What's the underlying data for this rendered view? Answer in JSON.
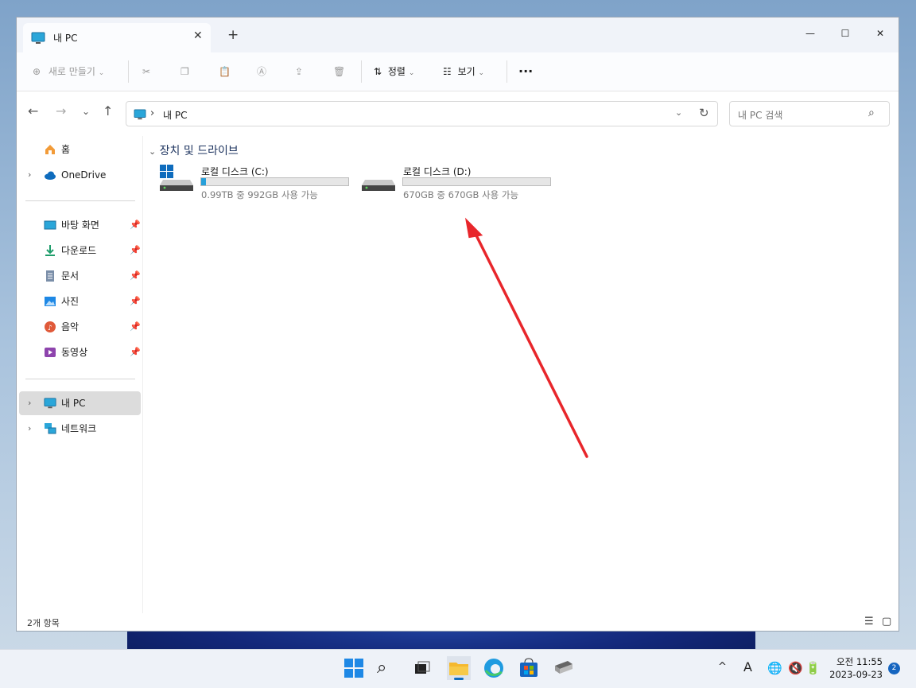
{
  "window": {
    "tab_title": "내 PC",
    "new_tab": "+",
    "minimize": "—",
    "maximize": "☐",
    "close": "✕"
  },
  "toolbar": {
    "new_label": "새로 만들기",
    "sort_label": "정렬",
    "view_label": "보기",
    "more": "···"
  },
  "address": {
    "path": "내 PC",
    "search_placeholder": "내 PC 검색"
  },
  "sidebar": {
    "items": [
      {
        "label": "홈"
      },
      {
        "label": "OneDrive"
      },
      {
        "label": "바탕 화면"
      },
      {
        "label": "다운로드"
      },
      {
        "label": "문서"
      },
      {
        "label": "사진"
      },
      {
        "label": "음악"
      },
      {
        "label": "동영상"
      },
      {
        "label": "내 PC"
      },
      {
        "label": "네트워크"
      }
    ]
  },
  "content": {
    "group_title": "장치 및 드라이브",
    "drives": [
      {
        "name": "로컬 디스크 (C:)",
        "info": "0.99TB 중 992GB 사용 가능",
        "used_fraction": 0.03
      },
      {
        "name": "로컬 디스크 (D:)",
        "info": "670GB 중 670GB 사용 가능",
        "used_fraction": 0.0
      }
    ]
  },
  "status": {
    "items_count": "2개 항목"
  },
  "taskbar": {
    "clock_period_time": "오전 11:55",
    "date": "2023-09-23",
    "notification_count": "2",
    "ime": "A",
    "tray_up": "^"
  },
  "colors": {
    "accent": "#26a0da",
    "annotation_arrow": "#e8262b"
  }
}
